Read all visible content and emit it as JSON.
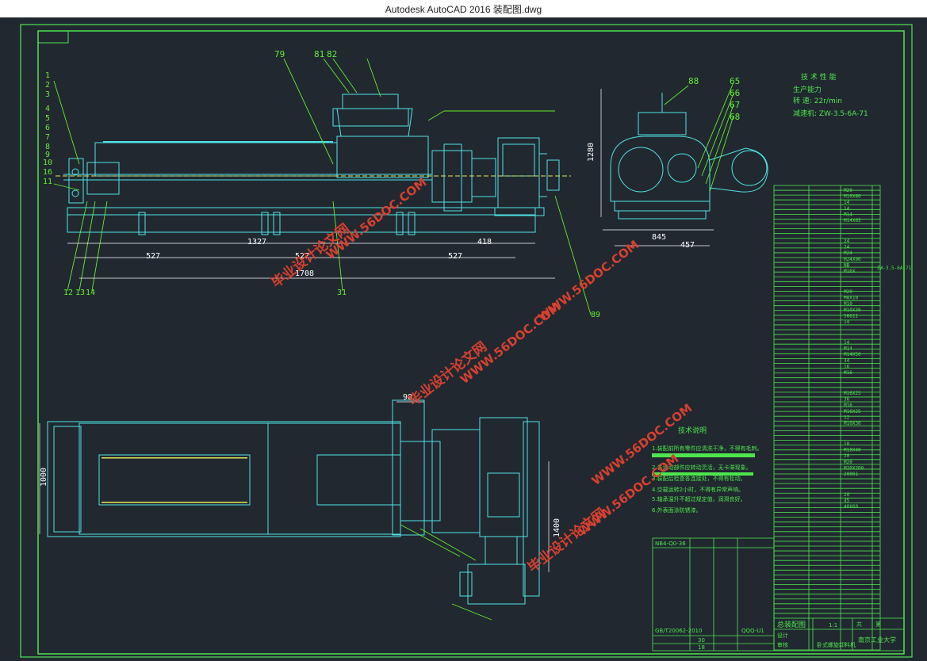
{
  "window": {
    "title": "Autodesk AutoCAD 2016     装配图.dwg"
  },
  "colors": {
    "background": "#212830",
    "frame": "#4ee64e",
    "geometry": "#4fe3e6",
    "leader": "#62ef2d",
    "dimension": "#ffffff",
    "watermark": "#d9402e"
  },
  "drawing": {
    "balloons_top": [
      "79",
      "81",
      "82",
      "88",
      "65",
      "66",
      "67",
      "68"
    ],
    "balloons_left": [
      "1",
      "2",
      "3",
      "4",
      "5",
      "6",
      "7",
      "8",
      "9",
      "10",
      "16",
      "11"
    ],
    "balloons_bottom": [
      "12",
      "13",
      "14",
      "31"
    ],
    "balloon_right": "89",
    "dimensions": {
      "d1327": "1327",
      "d527a": "527",
      "d527b": "527",
      "d527c": "527",
      "d1708": "1708",
      "d418": "418",
      "d845": "845",
      "d457": "457",
      "d1280": "1280",
      "d1400": "1400",
      "d1000": "1000",
      "d98": "98"
    },
    "tech_performance": {
      "title": "技 术 性 能",
      "line1": "生产能力",
      "line2": "转  速:      22r/min",
      "line3": "减速机:   ZW-3.5-6A-71"
    },
    "tech_notes": {
      "title": "技术说明",
      "lines": [
        "1.装配前所有零件应清洗干净，不得有毛刺。",
        "2.各运动部件应转动灵活，无卡滞现象。",
        "3.装配后检查各连接处，不得有松动。",
        "4.空载运转2小时，不得有异常声响。",
        "5.轴承温升不超过规定值，润滑良好。",
        "6.外表面涂防锈漆。"
      ]
    },
    "bom_texts": [
      "M20",
      "M10X80",
      "14",
      "14",
      "M14",
      "M14X65",
      "24",
      "24",
      "M24",
      "M24X90",
      "NB",
      "M16X",
      "M20",
      "M8X10",
      "M10",
      "M10X30",
      "58611",
      "14",
      "14",
      "M14",
      "M14X50",
      "34",
      "16",
      "M16",
      "M16X25",
      "36",
      "M16",
      "M16X25",
      "12",
      "M10X30",
      "10",
      "M10X40",
      "20",
      "M20",
      "M20X200",
      "20001",
      "20",
      "45",
      "40X60"
    ],
    "bom_side_note": "ZW-3.5-6A-71",
    "title_block": {
      "drawing_name": "总装配图",
      "scale": "1:1",
      "school": "南京工业大学",
      "product": "卧式螺旋卸料机",
      "code_left": "NB4-Q0-36",
      "std_code": "GB/T20062-2010",
      "sheet1": "共",
      "sheet2": "第",
      "field_a": "设计",
      "field_b": "审核",
      "num_a": "30",
      "num_b": "18",
      "ref": "QQQ-U1"
    },
    "watermarks": [
      "毕业设计论文网",
      "WWW.56DOC.COM"
    ]
  }
}
